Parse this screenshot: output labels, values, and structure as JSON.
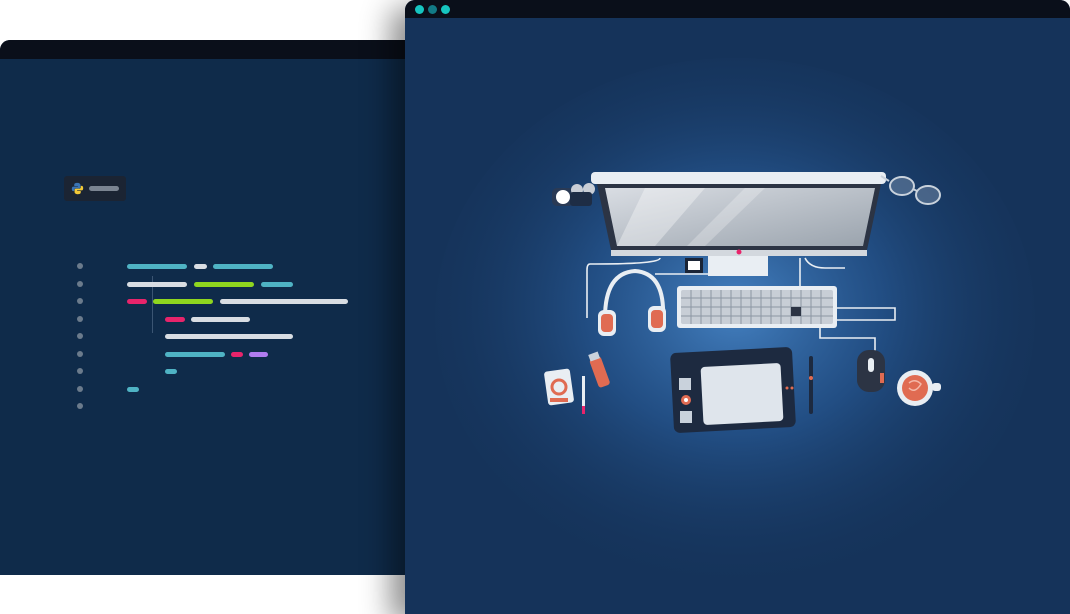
{
  "windows": {
    "back": {
      "type": "code-editor",
      "language_icon": "python-icon"
    },
    "front": {
      "type": "illustration",
      "subject": "desk-setup"
    }
  },
  "colors": {
    "editor_bg": "#0f2b4a",
    "titlebar": "#0a0f1a",
    "teal": "#4fb3c4",
    "lime": "#8fd61f",
    "pink": "#e8246b",
    "purple": "#b07cf0",
    "white_token": "#d8dde3",
    "window_dot": "#16c5c0",
    "scene_bg": "#15335a"
  },
  "icons": [
    "python-icon",
    "monitor-icon",
    "gamepad-icon",
    "glasses-icon",
    "headphones-icon",
    "keyboard-icon",
    "drawing-tablet-icon",
    "mouse-icon",
    "coffee-cup-icon",
    "camera-card-icon",
    "lighter-icon",
    "pen-icon",
    "stylus-icon"
  ]
}
